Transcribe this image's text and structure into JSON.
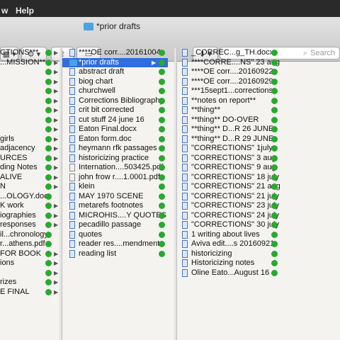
{
  "menubar": {
    "left_item": "w",
    "help": "Help"
  },
  "window": {
    "title": "*prior drafts"
  },
  "toolbar": {
    "dropbox_label": "⬇ ▾",
    "search_placeholder": "Search"
  },
  "col1": [
    {
      "label": "CTIONS***",
      "arrow": true
    },
    {
      "label": "...MISSION**",
      "arrow": true
    },
    {
      "label": "",
      "arrow": true
    },
    {
      "label": "",
      "arrow": true
    },
    {
      "label": "",
      "arrow": true
    },
    {
      "label": "",
      "arrow": true
    },
    {
      "label": "",
      "arrow": true
    },
    {
      "label": "",
      "arrow": true
    },
    {
      "label": "",
      "arrow": true
    },
    {
      "label": "girls",
      "arrow": true
    },
    {
      "label": "adjacency",
      "arrow": true
    },
    {
      "label": "URCES",
      "arrow": true
    },
    {
      "label": "ding Notes",
      "arrow": true
    },
    {
      "label": "ALIVE",
      "arrow": true
    },
    {
      "label": "N",
      "arrow": true
    },
    {
      "label": "...OLOGY.doc",
      "arrow": false
    },
    {
      "label": "K work",
      "arrow": true
    },
    {
      "label": "iographies",
      "arrow": true
    },
    {
      "label": "responses",
      "arrow": true
    },
    {
      "label": "il...chronology",
      "arrow": false
    },
    {
      "label": "r...athens.pdf",
      "arrow": false
    },
    {
      "label": "FOR BOOK",
      "arrow": true
    },
    {
      "label": "ions",
      "arrow": true
    },
    {
      "label": "",
      "arrow": true
    },
    {
      "label": "rizes",
      "arrow": true
    },
    {
      "label": "E FINAL",
      "arrow": true
    }
  ],
  "col2": [
    {
      "label": "****OE corr....20161004",
      "type": "word"
    },
    {
      "label": "*prior drafts",
      "type": "folder",
      "selected": true,
      "arrow": true
    },
    {
      "label": "abstract draft",
      "type": "word"
    },
    {
      "label": "biog chart",
      "type": "word"
    },
    {
      "label": "churchwell",
      "type": "word"
    },
    {
      "label": "Corrections Bibliography",
      "type": "word"
    },
    {
      "label": "crit bit corrected",
      "type": "word"
    },
    {
      "label": "cut stuff 24 june 16",
      "type": "word"
    },
    {
      "label": "Eaton Final.docx",
      "type": "word"
    },
    {
      "label": "Eaton form.doc",
      "type": "word"
    },
    {
      "label": "heymann rfk passages",
      "type": "word"
    },
    {
      "label": "historicizing practice",
      "type": "word"
    },
    {
      "label": "Internation....503425.pdf",
      "type": "pdf"
    },
    {
      "label": "john frow r....1.0001.pdf",
      "type": "pdf"
    },
    {
      "label": "klein",
      "type": "word"
    },
    {
      "label": "MAY 1970 SCENE",
      "type": "word"
    },
    {
      "label": "metarefs footnotes",
      "type": "word"
    },
    {
      "label": "MICROHIS....Y QUOTES",
      "type": "word"
    },
    {
      "label": "pecadillo passage",
      "type": "word"
    },
    {
      "label": "quotes",
      "type": "word"
    },
    {
      "label": "reader res....mendments",
      "type": "word"
    },
    {
      "label": "reading list",
      "type": "word"
    }
  ],
  "col3": [
    {
      "label": "_CORREC...g_TH.docx",
      "type": "word"
    },
    {
      "label": "****CORRE....NS\" 23 aug",
      "type": "word"
    },
    {
      "label": "****OE corr....20160922",
      "type": "word"
    },
    {
      "label": "****OE corr....20160929",
      "type": "word"
    },
    {
      "label": "***15sept1...corrections",
      "type": "word"
    },
    {
      "label": "**notes on report**",
      "type": "word"
    },
    {
      "label": "**thing**",
      "type": "word"
    },
    {
      "label": "**thing** DO-OVER",
      "type": "word"
    },
    {
      "label": "**thing** D...R 26 JUNE",
      "type": "word"
    },
    {
      "label": "**thing** D...R 29 JUNE",
      "type": "word"
    },
    {
      "label": "\"CORRECTIONS\" 1july",
      "type": "word"
    },
    {
      "label": "\"CORRECTIONS\" 3 aug",
      "type": "word"
    },
    {
      "label": "\"CORRECTIONS\" 9 aug",
      "type": "word"
    },
    {
      "label": "\"CORRECTIONS\" 18 july",
      "type": "word"
    },
    {
      "label": "\"CORRECTIONS\" 21 aug",
      "type": "word"
    },
    {
      "label": "\"CORRECTIONS\" 21 july",
      "type": "word"
    },
    {
      "label": "\"CORRECTIONS\" 23 july",
      "type": "word"
    },
    {
      "label": "\"CORRECTIONS\" 24 july",
      "type": "word"
    },
    {
      "label": "\"CORRECTIONS\" 30 july",
      "type": "word"
    },
    {
      "label": "1 writing about lives",
      "type": "word"
    },
    {
      "label": "Aviva edit....s 20160921",
      "type": "word"
    },
    {
      "label": "historicizing",
      "type": "word"
    },
    {
      "label": "Historicizing notes",
      "type": "word"
    },
    {
      "label": "Oline Eato...August 16",
      "type": "word"
    }
  ]
}
